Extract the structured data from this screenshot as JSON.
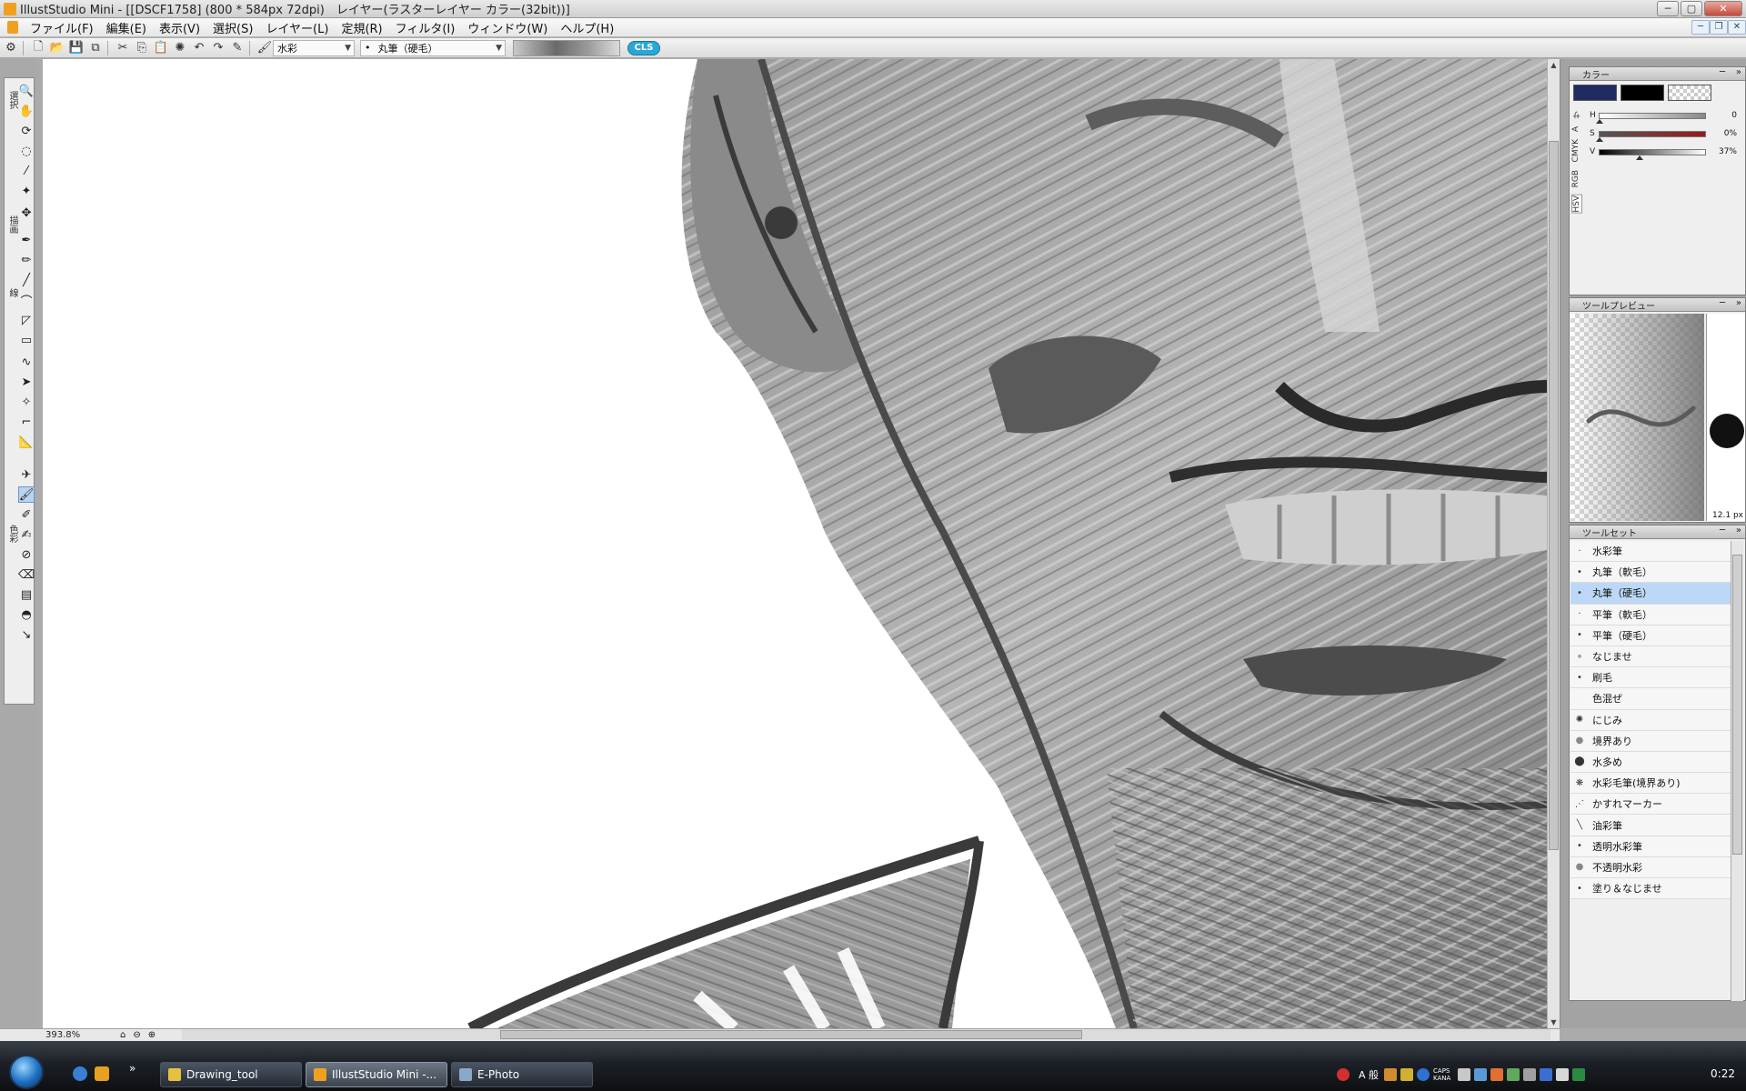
{
  "window": {
    "title": "IllustStudio Mini - [[DSCF1758] (800 * 584px 72dpi)　レイヤー(ラスターレイヤー カラー(32bit))]"
  },
  "menu": [
    "ファイル(F)",
    "編集(E)",
    "表示(V)",
    "選択(S)",
    "レイヤー(L)",
    "定規(R)",
    "フィルタ(I)",
    "ウィンドウ(W)",
    "ヘルプ(H)"
  ],
  "tool_options": {
    "brush_category": "水彩",
    "brush_name": "丸筆（硬毛）",
    "badge": "CLS"
  },
  "toolbox": {
    "groups": [
      "選択",
      "描画",
      "線",
      "色彩"
    ]
  },
  "status": {
    "zoom": "393.8%"
  },
  "color_panel": {
    "title": "カラー",
    "tabs": [
      "HSV",
      "RGB",
      "CMYK",
      "A",
      "サ"
    ],
    "sliders": [
      {
        "label": "H",
        "value": "0",
        "level": 0.0,
        "color": "#888888"
      },
      {
        "label": "S",
        "value": "0%",
        "level": 0.0,
        "color": "#9b1a1a"
      },
      {
        "label": "V",
        "value": "37%",
        "level": 0.37,
        "color": "#444444"
      }
    ],
    "colors": {
      "main": "#1e2a60",
      "sub": "#000000"
    }
  },
  "preview_panel": {
    "title": "ツールプレビュー",
    "size": "12.1 px"
  },
  "toolset_panel": {
    "title": "ツールセット",
    "items": [
      {
        "name": "水彩筆",
        "icon": "tiny-dot"
      },
      {
        "name": "丸筆（軟毛）",
        "icon": "dot"
      },
      {
        "name": "丸筆（硬毛）",
        "icon": "dot",
        "active": true
      },
      {
        "name": "平筆（軟毛）",
        "icon": "tiny-dot"
      },
      {
        "name": "平筆（硬毛）",
        "icon": "dot"
      },
      {
        "name": "なじませ",
        "icon": "soft-dot"
      },
      {
        "name": "刷毛",
        "icon": "dot"
      },
      {
        "name": "色混ぜ",
        "icon": "none"
      },
      {
        "name": "にじみ",
        "icon": "blot"
      },
      {
        "name": "境界あり",
        "icon": "large-circle"
      },
      {
        "name": "水多め",
        "icon": "large-dark-circle"
      },
      {
        "name": "水彩毛筆(境界あり)",
        "icon": "splatter"
      },
      {
        "name": "かすれマーカー",
        "icon": "faint"
      },
      {
        "name": "油彩筆",
        "icon": "stroke"
      },
      {
        "name": "透明水彩筆",
        "icon": "dot"
      },
      {
        "name": "不透明水彩",
        "icon": "large-circle"
      },
      {
        "name": "塗り＆なじませ",
        "icon": "dot"
      }
    ]
  },
  "taskbar": {
    "tasks": [
      {
        "label": "Drawing_tool",
        "active": false
      },
      {
        "label": "IllustStudio Mini -...",
        "active": true
      },
      {
        "label": "E-Photo",
        "active": false
      }
    ],
    "tray": {
      "ime": "A 般",
      "caps": "CAPS",
      "kana": "KANA",
      "time": "0:22"
    }
  }
}
